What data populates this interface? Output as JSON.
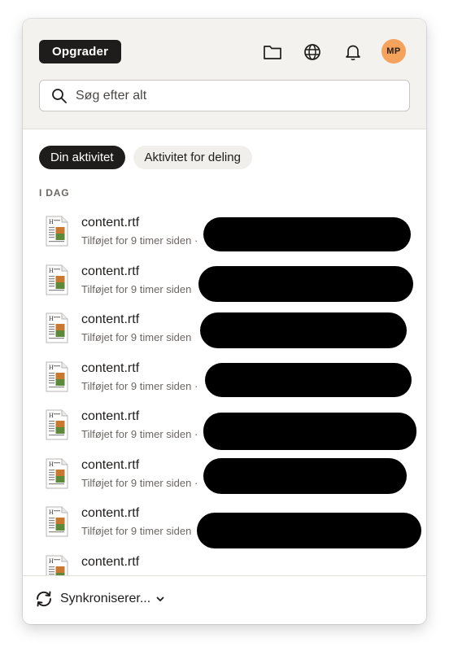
{
  "header": {
    "upgrade_label": "Opgrader",
    "icons": [
      "folder-icon",
      "globe-icon",
      "bell-icon"
    ],
    "avatar_initials": "MP",
    "avatar_color": "#f4a25c"
  },
  "search": {
    "placeholder": "Søg efter alt",
    "value": ""
  },
  "tabs": [
    {
      "label": "Din aktivitet",
      "active": true
    },
    {
      "label": "Aktivitet for deling",
      "active": false
    }
  ],
  "section": {
    "label": "I DAG"
  },
  "activity": [
    {
      "name": "content.rtf",
      "meta": "Tilføjet for 9 timer siden ·"
    },
    {
      "name": "content.rtf",
      "meta": "Tilføjet for 9 timer siden"
    },
    {
      "name": "content.rtf",
      "meta": "Tilføjet for 9 timer siden"
    },
    {
      "name": "content.rtf",
      "meta": "Tilføjet for 9 timer siden ·"
    },
    {
      "name": "content.rtf",
      "meta": "Tilføjet for 9 timer siden ·"
    },
    {
      "name": "content.rtf",
      "meta": "Tilføjet for 9 timer siden ·"
    },
    {
      "name": "content.rtf",
      "meta": "Tilføjet for 9 timer siden"
    },
    {
      "name": "content.rtf",
      "meta": ""
    }
  ],
  "footer": {
    "sync_label": "Synkroniserer..."
  }
}
